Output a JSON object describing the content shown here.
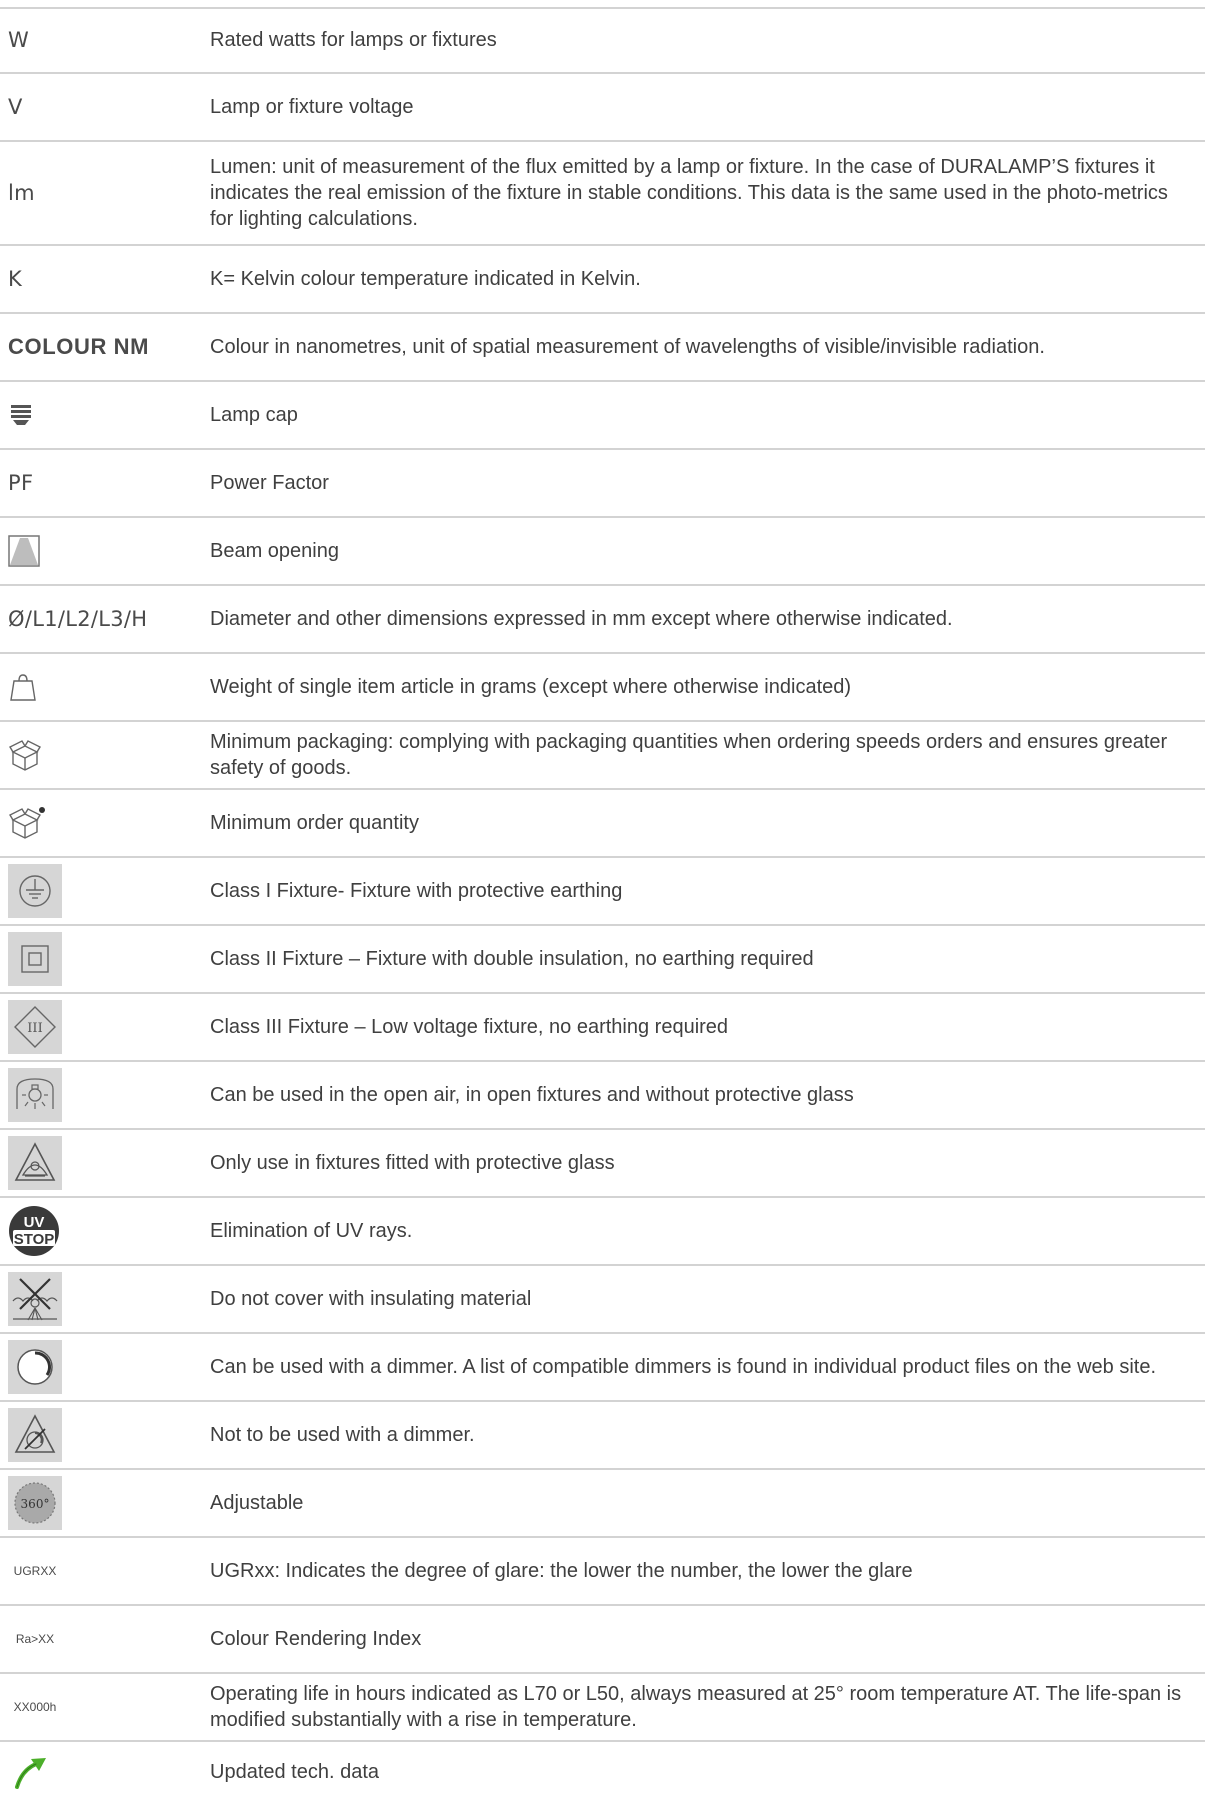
{
  "rows": [
    {
      "symbol": "W",
      "description": "Rated watts for lamps or fixtures"
    },
    {
      "symbol": "V",
      "description": "Lamp or fixture voltage"
    },
    {
      "symbol": "lm",
      "description": "Lumen: unit of measurement of the flux emitted by a lamp or fixture. In the case of DURALAMP’S fixtures it indicates the real emission of the fixture in stable conditions. This data is the same used in the photo-metrics for lighting calculations."
    },
    {
      "symbol": "K",
      "description": "K= Kelvin colour temperature indicated in Kelvin."
    },
    {
      "symbol": "COLOUR NM",
      "description": "Colour in nanometres, unit of spatial measurement of wavelengths of visible/invisible radiation."
    },
    {
      "icon": "lamp-cap-icon",
      "description": "Lamp cap"
    },
    {
      "symbol": "PF",
      "description": "Power Factor"
    },
    {
      "icon": "beam-opening-icon",
      "description": "Beam opening"
    },
    {
      "symbol": "Ø/L1/L2/L3/H",
      "description": "Diameter and other dimensions expressed in mm except where otherwise indicated."
    },
    {
      "icon": "weight-bag-icon",
      "description": "Weight of single item article in grams (except where otherwise indicated)"
    },
    {
      "icon": "minimum-packaging-icon",
      "description": "Minimum packaging: complying with packaging quantities when ordering speeds orders and ensures greater safety of goods."
    },
    {
      "icon": "minimum-order-icon",
      "description": "Minimum order quantity"
    },
    {
      "icon": "class-i-earth-icon",
      "description": "Class I Fixture- Fixture with protective earthing"
    },
    {
      "icon": "class-ii-double-insulation-icon",
      "description": "Class II Fixture – Fixture with double insulation, no earthing required"
    },
    {
      "icon": "class-iii-low-voltage-icon",
      "description": "Class III Fixture – Low voltage fixture, no earthing required"
    },
    {
      "icon": "open-air-use-icon",
      "description": "Can be used in the open air, in open fixtures and without protective glass"
    },
    {
      "icon": "protective-glass-icon",
      "description": "Only use in fixtures fitted with protective glass"
    },
    {
      "icon": "uv-stop-icon",
      "icon_text_top": "UV",
      "icon_text_bottom": "STOP",
      "description": "Elimination of UV rays."
    },
    {
      "icon": "no-insulation-cover-icon",
      "description": "Do not cover with insulating material"
    },
    {
      "icon": "dimmable-icon",
      "description": "Can be used with a dimmer. A list of compatible dimmers is found in individual product files on the web site."
    },
    {
      "icon": "not-dimmable-icon",
      "description": "Not to be used with a dimmer."
    },
    {
      "icon": "adjustable-360-icon",
      "icon_text": "360°",
      "description": "Adjustable"
    },
    {
      "code": "UGRXX",
      "description": "UGRxx: Indicates the degree of glare: the lower the number, the lower the glare"
    },
    {
      "code": "Ra>XX",
      "description": "Colour Rendering Index"
    },
    {
      "code": "XX000h",
      "description": "Operating life in hours indicated as L70 or L50, always measured at 25° room temperature AT. The life-span is modified substantially with a rise in temperature."
    },
    {
      "icon": "updated-arrow-icon",
      "description": "Updated tech. data"
    }
  ],
  "colors": {
    "rule": "#d3d3d3",
    "icon_bg": "#d6d6d6",
    "text": "#3f3f3f",
    "arrow_green": "#4caf2a"
  }
}
